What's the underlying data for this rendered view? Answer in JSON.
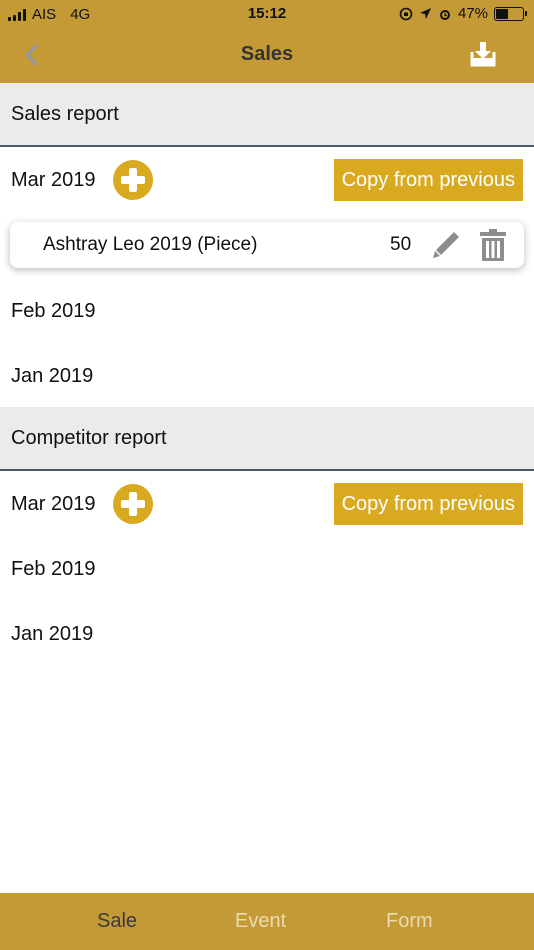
{
  "status_bar": {
    "carrier": "AIS",
    "network": "4G",
    "time": "15:12",
    "battery_percent": "47%",
    "battery_level": 0.47
  },
  "nav": {
    "title": "Sales",
    "back_icon": "chevron-left-icon",
    "download_icon": "download-tray-icon"
  },
  "sales_report": {
    "header": "Sales report",
    "months": [
      {
        "label": "Mar 2019",
        "copy_label": "Copy from previous"
      },
      {
        "label": "Feb 2019"
      },
      {
        "label": "Jan 2019"
      }
    ],
    "items": [
      {
        "name": "Ashtray Leo 2019 (Piece)",
        "qty": "50"
      }
    ]
  },
  "competitor_report": {
    "header": "Competitor report",
    "months": [
      {
        "label": "Mar 2019",
        "copy_label": "Copy from previous"
      },
      {
        "label": "Feb 2019"
      },
      {
        "label": "Jan 2019"
      }
    ]
  },
  "tabs": [
    {
      "label": "Sale",
      "active": true
    },
    {
      "label": "Event",
      "active": false
    },
    {
      "label": "Form",
      "active": false
    }
  ],
  "colors": {
    "bar_gold": "#c39a35",
    "accent_yellow": "#d9a920",
    "section_bg": "#ebebeb",
    "divider": "#4a5a70"
  }
}
